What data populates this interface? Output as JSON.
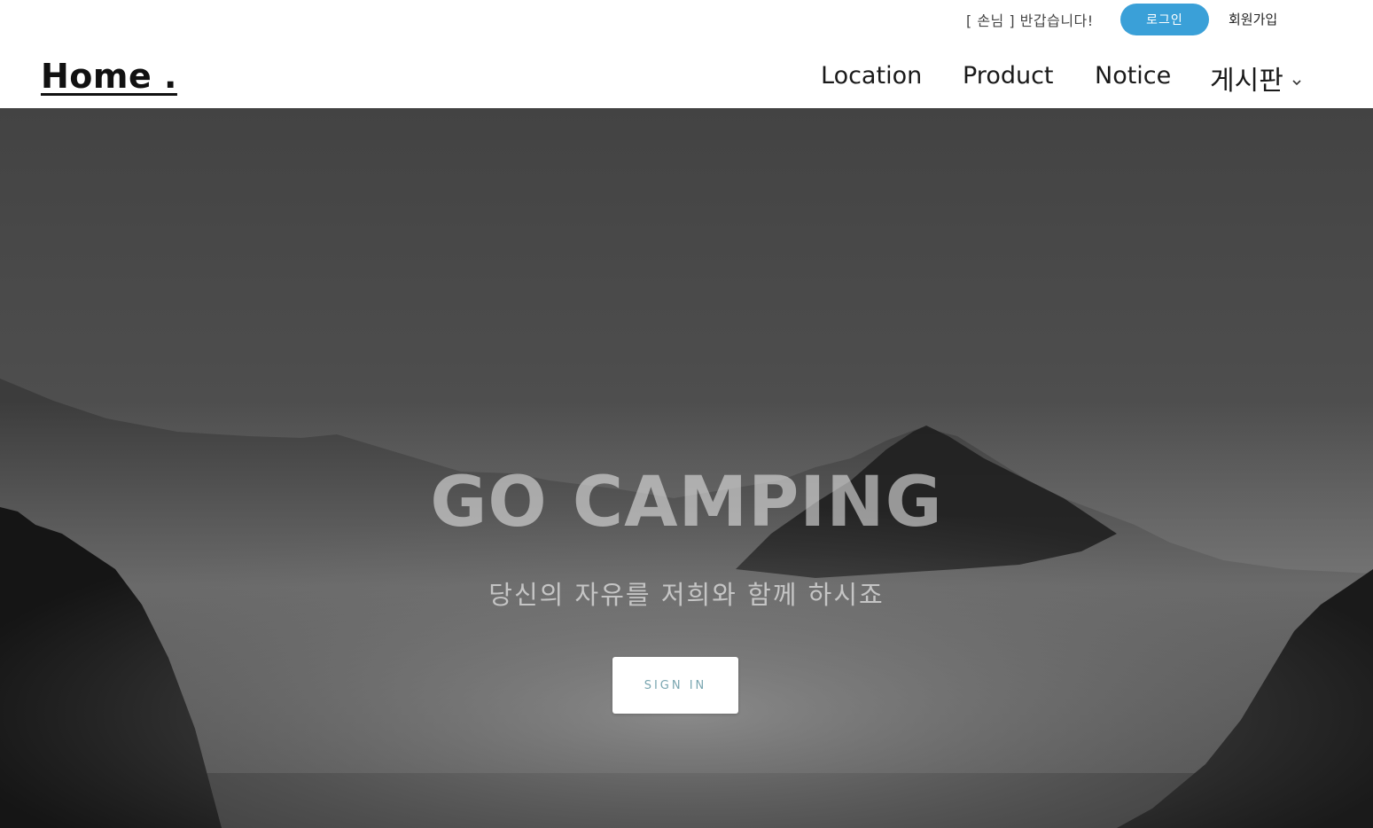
{
  "topbar": {
    "greeting": "[ 손님 ] 반갑습니다!",
    "login_label": "로그인",
    "signup_label": "회원가입"
  },
  "header": {
    "logo": "Home ."
  },
  "nav": {
    "items": [
      {
        "label": "Location"
      },
      {
        "label": "Product"
      },
      {
        "label": "Notice"
      },
      {
        "label": "게시판"
      }
    ]
  },
  "hero": {
    "title": "GO CAMPING",
    "subtitle": "당신의 자유를 저희와 함께 하시죠",
    "cta_label": "SIGN IN"
  },
  "colors": {
    "login_button": "#3aa0d8",
    "cta_text": "#7aa6b0"
  },
  "icons": {
    "dropdown": "chevron-down-icon"
  }
}
